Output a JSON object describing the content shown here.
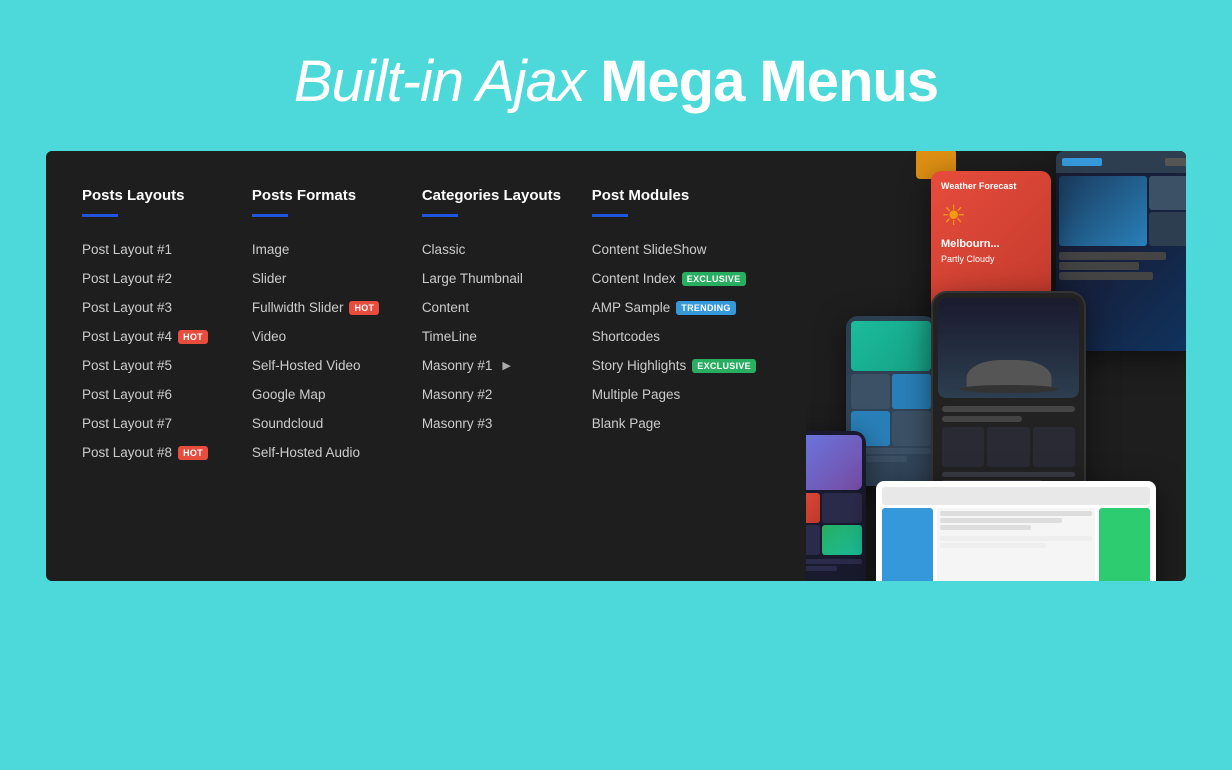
{
  "page": {
    "background_color": "#4dd9d9"
  },
  "hero": {
    "title_regular": "Built-in Ajax ",
    "title_bold": "Mega Menus"
  },
  "megamenu": {
    "columns": [
      {
        "id": "posts-layouts",
        "title": "Posts Layouts",
        "items": [
          {
            "label": "Post Layout #1",
            "badge": null
          },
          {
            "label": "Post Layout #2",
            "badge": null
          },
          {
            "label": "Post Layout #3",
            "badge": null
          },
          {
            "label": "Post Layout #4",
            "badge": "HOT"
          },
          {
            "label": "Post Layout #5",
            "badge": null
          },
          {
            "label": "Post Layout #6",
            "badge": null
          },
          {
            "label": "Post Layout #7",
            "badge": null
          },
          {
            "label": "Post Layout #8",
            "badge": "HOT"
          }
        ]
      },
      {
        "id": "posts-formats",
        "title": "Posts Formats",
        "items": [
          {
            "label": "Image",
            "badge": null
          },
          {
            "label": "Slider",
            "badge": null
          },
          {
            "label": "Fullwidth Slider",
            "badge": "HOT"
          },
          {
            "label": "Video",
            "badge": null
          },
          {
            "label": "Self-Hosted Video",
            "badge": null
          },
          {
            "label": "Google Map",
            "badge": null
          },
          {
            "label": "Soundcloud",
            "badge": null
          },
          {
            "label": "Self-Hosted Audio",
            "badge": null
          }
        ]
      },
      {
        "id": "categories-layouts",
        "title": "Categories Layouts",
        "items": [
          {
            "label": "Classic",
            "badge": null
          },
          {
            "label": "Large Thumbnail",
            "badge": null
          },
          {
            "label": "Content",
            "badge": null
          },
          {
            "label": "TimeLine",
            "badge": null
          },
          {
            "label": "Masonry #1",
            "badge": null,
            "arrow": true
          },
          {
            "label": "Masonry #2",
            "badge": null
          },
          {
            "label": "Masonry #3",
            "badge": null
          }
        ]
      },
      {
        "id": "post-modules",
        "title": "Post Modules",
        "items": [
          {
            "label": "Content SlideShow",
            "badge": null
          },
          {
            "label": "Content Index",
            "badge": "EXCLUSIVE"
          },
          {
            "label": "AMP Sample",
            "badge": "TRENDING"
          },
          {
            "label": "Shortcodes",
            "badge": null
          },
          {
            "label": "Story Highlights",
            "badge": "EXCLUSIVE"
          },
          {
            "label": "Multiple Pages",
            "badge": null
          },
          {
            "label": "Blank Page",
            "badge": null
          }
        ]
      }
    ]
  }
}
